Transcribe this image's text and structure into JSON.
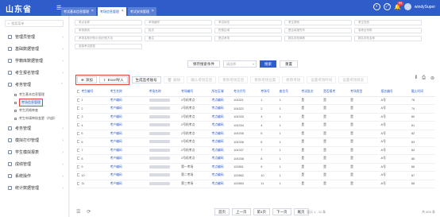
{
  "app": {
    "title": "山东省",
    "user": "windySuper",
    "notify_count": "99"
  },
  "tabs": [
    {
      "label": "考试基本信息管理"
    },
    {
      "label": "考场信息管理"
    },
    {
      "label": "考试安排管理"
    }
  ],
  "sidebar": {
    "search_placeholder": "搜索菜单",
    "items": [
      {
        "label": "管理员管理"
      },
      {
        "label": "基础数据管理"
      },
      {
        "label": "学籍库数据管理"
      },
      {
        "label": "考生报名管理"
      },
      {
        "label": "考务管理"
      }
    ],
    "subitems": [
      {
        "label": "考生基本信息管理"
      },
      {
        "label": "考场信息管理"
      },
      {
        "label": "考生资格审查"
      },
      {
        "label": "考生申请审核变更（内部）"
      }
    ],
    "items2": [
      {
        "label": "考务管理"
      },
      {
        "label": "模拟打印管理"
      },
      {
        "label": "学生模拟报表"
      },
      {
        "label": "成绩管理"
      },
      {
        "label": "系统操作"
      },
      {
        "label": "统计数据管理"
      }
    ]
  },
  "filters": [
    [
      "考点名称",
      "考场编号",
      "考试状态",
      "考生类别",
      "考生性别"
    ],
    [
      "考场类别",
      "批次",
      "所属区域",
      "是否填报完毕",
      "准考证号码"
    ],
    [
      "考场名称识别/计划识别方法",
      "备注",
      "是否考场",
      "报名学校简称",
      "报名学校名称"
    ],
    [
      "选择考试类型"
    ]
  ],
  "adv": {
    "button": "保存搜索条件",
    "select_placeholder": "请选择",
    "search": "搜索",
    "reset": "重置"
  },
  "toolbar": {
    "add": "添加",
    "import": "Excel导入",
    "gen": "生成监考账号",
    "del": "删除",
    "b1": "确认考场信息",
    "b2": "更新考场信息",
    "b3": "更新考场位置",
    "b4": "修改考场",
    "b5": "设置考场时间",
    "b6": "设置考场状态"
  },
  "table": {
    "headers": [
      "",
      "考生编号",
      "考生名称",
      "考场名称",
      "考场编号",
      "所在区域",
      "考点代号",
      "考场号",
      "座位号",
      "考试批次",
      "是否报考",
      "考场类型",
      "报名编号",
      "截止时间"
    ],
    "rows": [
      [
        "1",
        "考户编码",
        "2号机考点",
        "考点编码",
        "104321",
        "1",
        "1",
        "是",
        "是",
        "是",
        "A号",
        "78"
      ],
      [
        "2",
        "考户编码",
        "2号机考点",
        "考点编码",
        "104322",
        "2",
        "1",
        "是",
        "是",
        "是",
        "A号",
        "79"
      ],
      [
        "3",
        "考户编码",
        "2号机考点",
        "考点编码",
        "104333",
        "3",
        "1",
        "是",
        "是",
        "是",
        "A号",
        "80"
      ],
      [
        "4",
        "考户编码",
        "2号机考点",
        "考点编码",
        "104334",
        "4",
        "1",
        "是",
        "是",
        "是",
        "A号",
        "81"
      ],
      [
        "5",
        "考户编码",
        "2号机考点",
        "考点编码",
        "104335",
        "5",
        "1",
        "是",
        "是",
        "是",
        "A号",
        "82"
      ],
      [
        "6",
        "考户编码",
        "2号机考点",
        "考点编码",
        "104336",
        "6",
        "1",
        "是",
        "是",
        "是",
        "A号",
        "83"
      ],
      [
        "7",
        "考户编码",
        "2号机考点",
        "考点编码",
        "104337",
        "7",
        "1",
        "是",
        "是",
        "是",
        "A号",
        "84"
      ],
      [
        "8",
        "考户编码",
        "2号机考点",
        "考点编码",
        "104338",
        "8",
        "1",
        "是",
        "是",
        "是",
        "A号",
        "85"
      ],
      [
        "9",
        "考户编码",
        "第一考场",
        "考点编码",
        "102861",
        "9",
        "1",
        "是",
        "是",
        "是",
        "A号",
        "86"
      ],
      [
        "10",
        "考户编码",
        "第二考场",
        "考点编码",
        "102862",
        "10",
        "1",
        "是",
        "是",
        "是",
        "A号",
        "87"
      ],
      [
        "11",
        "考户编码",
        "第三考场",
        "考点编码",
        "102863",
        "11",
        "1",
        "是",
        "是",
        "是",
        "A号",
        "88"
      ]
    ]
  },
  "pager": {
    "first": "首页",
    "prev": "上一页",
    "cur": "第1页",
    "next": "下一页",
    "last": "尾页",
    "info": "显示 1 - 11 条",
    "total": "共 625 条"
  }
}
